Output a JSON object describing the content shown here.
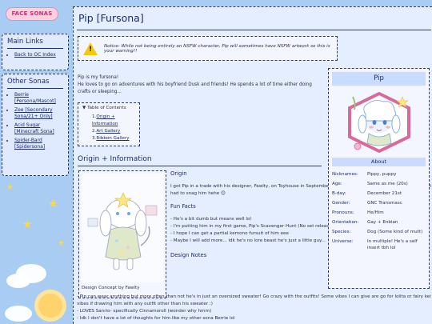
{
  "site": {
    "logo_text": "FACE SONAS"
  },
  "sidebar": {
    "main_links": {
      "heading": "Main Links",
      "items": [
        {
          "label": "Back to OC Index"
        }
      ]
    },
    "other_sonas": {
      "heading": "Other Sonas",
      "items": [
        {
          "label": "Berrie [Persona/Mascot]"
        },
        {
          "label": "Zee [Secondary Sona/21+ Only]"
        },
        {
          "label": "Acid Sugar [Minecraft Sona]"
        },
        {
          "label": "Spider-Bard [Spidersona]"
        }
      ]
    }
  },
  "page": {
    "title": "Pip [Fursona]",
    "notice": "Notice: While not being entirely an NSFW character, Pip will sometimes have NSFW artwork so this is your warning!!",
    "intro": [
      "Pip is my fursona!",
      "He loves to go on adventures with his boyfriend Dusk and friends! He spends a lot of time either doing crafts or sleeping..."
    ],
    "toc": {
      "heading": "Table of Contents",
      "items": [
        {
          "num": "1.",
          "label": "Origin + Information"
        },
        {
          "num": "2.",
          "label": "Art Gallery"
        },
        {
          "num": "3.",
          "label": "Ribbon Gallery"
        }
      ]
    },
    "section_heading": "Origin + Information",
    "design_caption": "Design Concept by Fawlty",
    "origin": {
      "heading": "Origin",
      "text": "I got Pip in a trade with his designer, Fawlty, on Toyhouse in September of 2023! I love his design so much and I just had to snag him hehe 😊"
    },
    "fun_facts": {
      "heading": "Fun Facts",
      "items": [
        "- He's a bit dumb but means well lol",
        "- I'm putting him in my first game, Pip's Scavenger Hunt (No set release date, I am a solo dev)!",
        "- I hope I can get a partial kemono fursuit of him eee",
        "- Maybe I will add more... idk he's no lore beast he's just a little guy..."
      ]
    },
    "design_notes": {
      "heading": "Design Notes",
      "items": [
        "- Pip can wear anything but more often than not he's in just an oversized sweater! Go crazy with the outfits! Some vibes I can give are go for lolita or fairy kei vibes if drawing him with any outfit other than his sweater :)",
        "- LOVES Sanrio- specifically Cinnamoroll (wonder why hmm)",
        "- Idk I don't have a lot of thoughts for him like my other sona Berrie lol"
      ]
    }
  },
  "infobox": {
    "title": "Pip",
    "about_label": "About",
    "rows": [
      {
        "key": "Nicknames:",
        "value": "Pippy, puppy"
      },
      {
        "key": "Age:",
        "value": "Same as me (20s)"
      },
      {
        "key": "B-day:",
        "value": "December 21st"
      },
      {
        "key": "Gender:",
        "value": "GNC Transmasc"
      },
      {
        "key": "Pronouns:",
        "value": "He/Him"
      },
      {
        "key": "Orientation:",
        "value": "Gay + Enbian"
      },
      {
        "key": "Species:",
        "value": "Dog (Some kind of mutt)"
      },
      {
        "key": "Universe:",
        "value": "In multiple! He's a self insert tbh lol"
      }
    ]
  },
  "colors": {
    "sky": "#a9cdf2",
    "panel": "#e4eeff",
    "accent": "#1d2c6b",
    "warning": "#f2c811",
    "portrait_frame": "#d86a9b"
  },
  "icons": {
    "notice": "warning-triangle-icon",
    "toc": "triangle-down-icon"
  }
}
